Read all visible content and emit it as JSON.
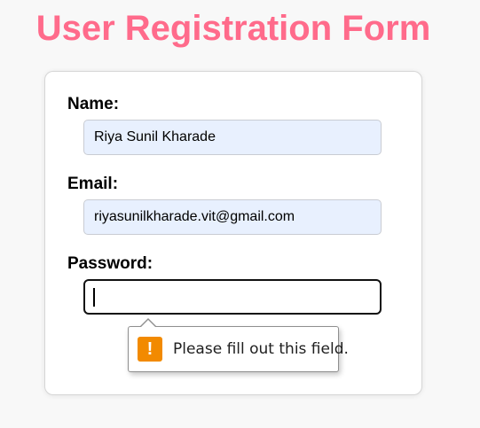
{
  "page": {
    "title": "User Registration Form"
  },
  "form": {
    "name_label": "Name:",
    "name_value": "Riya Sunil Kharade",
    "email_label": "Email:",
    "email_value": "riyasunilkharade.vit@gmail.com",
    "password_label": "Password:",
    "password_value": ""
  },
  "validation_tooltip": {
    "icon": "warning-icon",
    "message": "Please fill out this field."
  },
  "colors": {
    "title": "#ff6b8b",
    "autofill_background": "#e8f0fe",
    "warning_icon": "#f28a00"
  }
}
